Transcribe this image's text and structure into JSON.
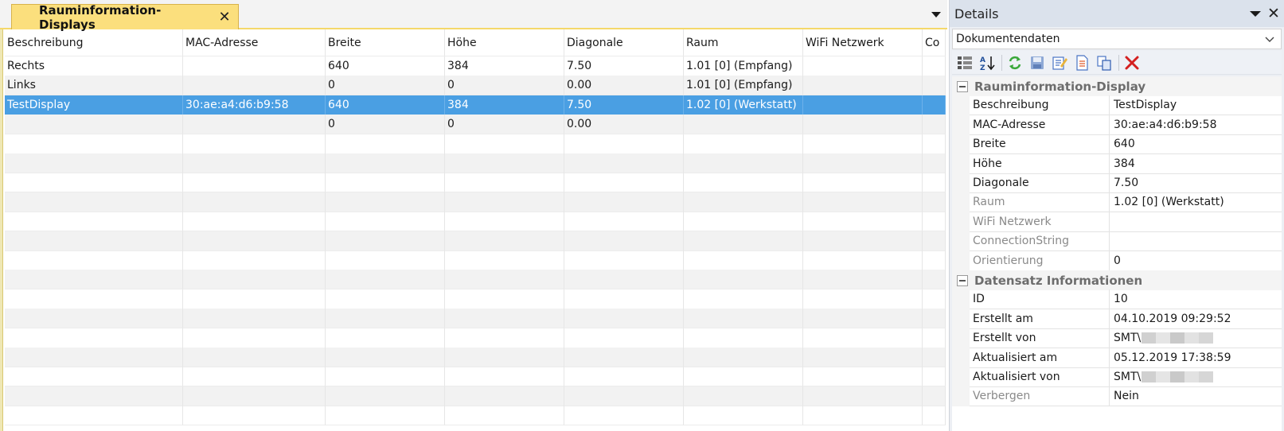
{
  "document_tab": {
    "label": "Rauminformation-Displays"
  },
  "grid": {
    "columns": [
      "Beschreibung",
      "MAC-Adresse",
      "Breite",
      "Höhe",
      "Diagonale",
      "Raum",
      "WiFi Netzwerk",
      "Co"
    ],
    "rows": [
      [
        "Rechts",
        "",
        "640",
        "384",
        "7.50",
        "1.01 [0] (Empfang)",
        "",
        ""
      ],
      [
        "Links",
        "",
        "0",
        "0",
        "0.00",
        "1.01 [0] (Empfang)",
        "",
        ""
      ],
      [
        "TestDisplay",
        "30:ae:a4:d6:b9:58",
        "640",
        "384",
        "7.50",
        "1.02 [0] (Werkstatt)",
        "",
        ""
      ],
      [
        "",
        "",
        "0",
        "0",
        "0.00",
        "",
        "",
        ""
      ]
    ],
    "selected_row": 2
  },
  "details": {
    "title": "Details",
    "document_select": "Dokumentendaten",
    "categories": [
      {
        "name": "Rauminformation-Display",
        "props": [
          {
            "name": "Beschreibung",
            "value": "TestDisplay",
            "dim": false
          },
          {
            "name": "MAC-Adresse",
            "value": "30:ae:a4:d6:b9:58",
            "dim": false
          },
          {
            "name": "Breite",
            "value": "640",
            "dim": false
          },
          {
            "name": "Höhe",
            "value": "384",
            "dim": false
          },
          {
            "name": "Diagonale",
            "value": "7.50",
            "dim": false
          },
          {
            "name": "Raum",
            "value": "1.02 [0] (Werkstatt)",
            "dim": true
          },
          {
            "name": "WiFi Netzwerk",
            "value": "",
            "dim": true
          },
          {
            "name": "ConnectionString",
            "value": "",
            "dim": true
          },
          {
            "name": "Orientierung",
            "value": "0",
            "dim": true
          }
        ]
      },
      {
        "name": "Datensatz Informationen",
        "props": [
          {
            "name": "ID",
            "value": "10",
            "dim": false
          },
          {
            "name": "Erstellt am",
            "value": "04.10.2019 09:29:52",
            "dim": false
          },
          {
            "name": "Erstellt von",
            "value": "SMT\\",
            "dim": false,
            "redacted": true
          },
          {
            "name": "Aktualisiert am",
            "value": "05.12.2019 17:38:59",
            "dim": false
          },
          {
            "name": "Aktualisiert von",
            "value": "SMT\\",
            "dim": false,
            "redacted": true
          },
          {
            "name": "Verbergen",
            "value": "Nein",
            "dim": true
          }
        ]
      }
    ]
  },
  "colors": {
    "tab_active": "#fbdf7d",
    "selection": "#4a9fe3",
    "details_header": "#dbe2ec"
  },
  "icons": [
    "categorized-icon",
    "sort-az-icon",
    "refresh-icon",
    "save-icon",
    "edit-icon",
    "new-document-icon",
    "copy-icon",
    "delete-icon"
  ]
}
